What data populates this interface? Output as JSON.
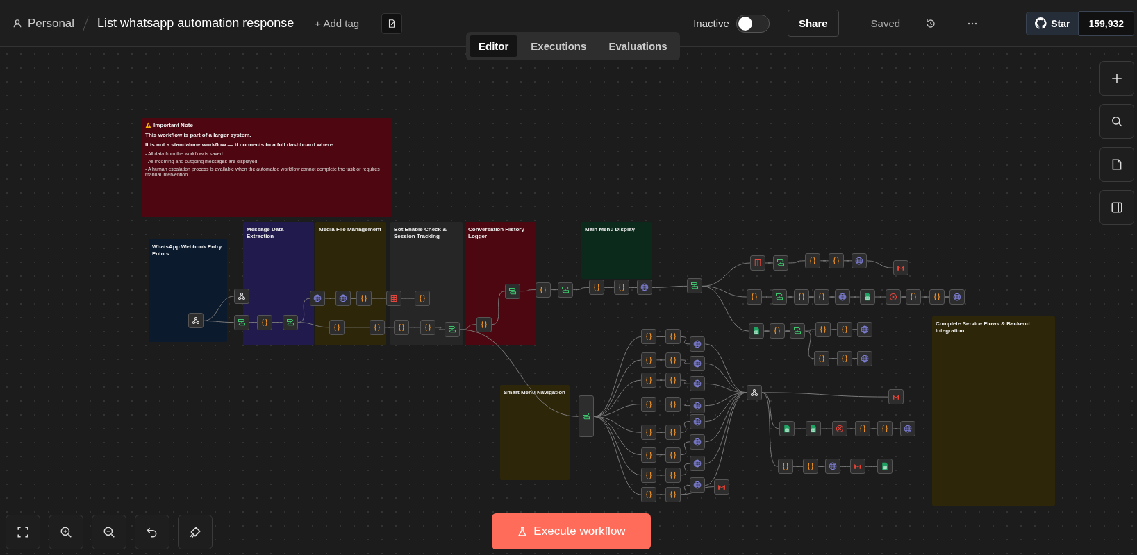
{
  "header": {
    "owner": "Personal",
    "title": "List whatsapp automation response",
    "add_tag": "+ Add tag",
    "status": {
      "label": "Inactive",
      "on": false
    },
    "share": "Share",
    "saved": "Saved",
    "github": {
      "label": "Star",
      "count": "159,932"
    }
  },
  "tabs": [
    {
      "label": "Editor",
      "selected": true
    },
    {
      "label": "Executions",
      "selected": false
    },
    {
      "label": "Evaluations",
      "selected": false
    }
  ],
  "notes": [
    {
      "kind": "important",
      "color": "#4e0710",
      "title": "Important Note",
      "lines": [
        "This workflow is part of a larger system.",
        "It is not a standalone workflow — it connects to a full dashboard where:"
      ],
      "bullets": [
        "- All data from the workflow is saved",
        "- All incoming and outgoing messages are displayed",
        "- A human escalation process is available when the automated workflow cannot complete the task or requires manual intervention"
      ]
    },
    {
      "kind": "section",
      "color": "#0b1a2c",
      "title": "WhatsApp Webhook Entry Points"
    },
    {
      "kind": "section",
      "color": "#211a4d",
      "title": "Message Data Extraction"
    },
    {
      "kind": "section",
      "color": "#2e2608",
      "title": "Media File Management"
    },
    {
      "kind": "section",
      "color": "#262626",
      "title": "Bot Enable Check & Session Tracking"
    },
    {
      "kind": "section",
      "color": "#4c0710",
      "title": "Conversation History Logger"
    },
    {
      "kind": "section",
      "color": "#0b2a1c",
      "title": "Main Menu Display"
    },
    {
      "kind": "section",
      "color": "#2e2608",
      "title": "Smart Menu Navigation"
    },
    {
      "kind": "section",
      "color": "#2e2608",
      "title": "Complete Service Flows & Backend Integration"
    }
  ],
  "nodes": [
    {
      "kind": "webhook"
    },
    {
      "kind": "webhook"
    },
    {
      "kind": "switch"
    },
    {
      "kind": "code"
    },
    {
      "kind": "switch"
    },
    {
      "kind": "http"
    },
    {
      "kind": "http"
    },
    {
      "kind": "code"
    },
    {
      "kind": "table"
    },
    {
      "kind": "code"
    },
    {
      "kind": "code"
    },
    {
      "kind": "code"
    },
    {
      "kind": "code"
    },
    {
      "kind": "code"
    },
    {
      "kind": "switch"
    },
    {
      "kind": "code"
    },
    {
      "kind": "switch"
    },
    {
      "kind": "code"
    },
    {
      "kind": "switch"
    },
    {
      "kind": "code"
    },
    {
      "kind": "code"
    },
    {
      "kind": "http"
    },
    {
      "kind": "switch"
    },
    {
      "kind": "table"
    },
    {
      "kind": "switch"
    },
    {
      "kind": "code"
    },
    {
      "kind": "code"
    },
    {
      "kind": "http"
    },
    {
      "kind": "gmail"
    },
    {
      "kind": "code"
    },
    {
      "kind": "switch"
    },
    {
      "kind": "code"
    },
    {
      "kind": "code"
    },
    {
      "kind": "http"
    },
    {
      "kind": "sheet"
    },
    {
      "kind": "stop"
    },
    {
      "kind": "code"
    },
    {
      "kind": "code"
    },
    {
      "kind": "http"
    },
    {
      "kind": "sheet"
    },
    {
      "kind": "code"
    },
    {
      "kind": "switch"
    },
    {
      "kind": "code"
    },
    {
      "kind": "code"
    },
    {
      "kind": "http"
    },
    {
      "kind": "code"
    },
    {
      "kind": "code"
    },
    {
      "kind": "http"
    },
    {
      "kind": "switch"
    },
    {
      "kind": "code"
    },
    {
      "kind": "code"
    },
    {
      "kind": "code"
    },
    {
      "kind": "code"
    },
    {
      "kind": "code"
    },
    {
      "kind": "code"
    },
    {
      "kind": "code"
    },
    {
      "kind": "code"
    },
    {
      "kind": "code"
    },
    {
      "kind": "code"
    },
    {
      "kind": "code"
    },
    {
      "kind": "code"
    },
    {
      "kind": "code"
    },
    {
      "kind": "code"
    },
    {
      "kind": "code"
    },
    {
      "kind": "code"
    },
    {
      "kind": "http"
    },
    {
      "kind": "http"
    },
    {
      "kind": "http"
    },
    {
      "kind": "http"
    },
    {
      "kind": "http"
    },
    {
      "kind": "http"
    },
    {
      "kind": "http"
    },
    {
      "kind": "http"
    },
    {
      "kind": "webhook"
    },
    {
      "kind": "gmail"
    },
    {
      "kind": "sheet"
    },
    {
      "kind": "sheet"
    },
    {
      "kind": "stop"
    },
    {
      "kind": "code"
    },
    {
      "kind": "code"
    },
    {
      "kind": "http"
    },
    {
      "kind": "code"
    },
    {
      "kind": "code"
    },
    {
      "kind": "http"
    },
    {
      "kind": "gmail"
    },
    {
      "kind": "sheet"
    },
    {
      "kind": "gmail"
    }
  ],
  "execute_button": "Execute workflow"
}
